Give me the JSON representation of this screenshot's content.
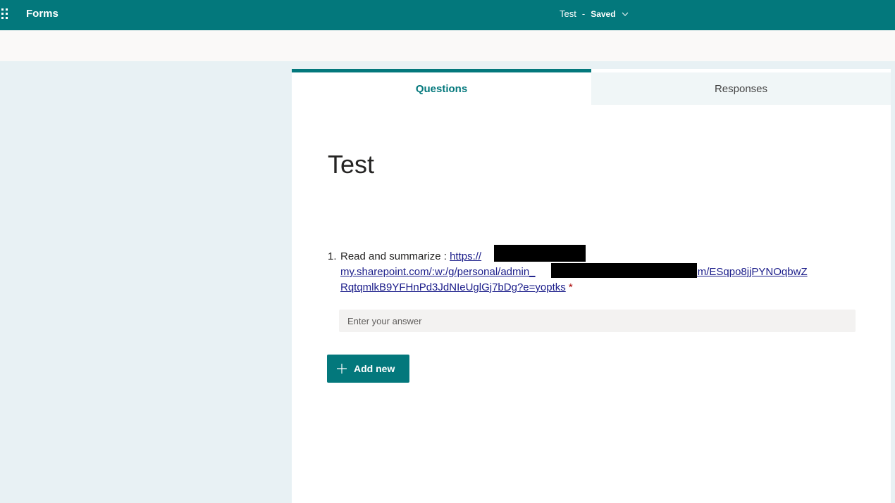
{
  "app": {
    "name": "Forms",
    "form_name": "Test",
    "separator": "-",
    "save_status": "Saved"
  },
  "tabs": [
    {
      "label": "Questions",
      "active": true
    },
    {
      "label": "Responses",
      "active": false
    }
  ],
  "form": {
    "title": "Test",
    "question": {
      "number": "1.",
      "prompt": "Read and summarize : ",
      "link_line1": "https://",
      "link_line2": "my.sharepoint.com/:w:/g/personal/admin_",
      "link_line2_end": "_com/ESqpo8jjPYNOqbwZ",
      "link_line3": "RqtqmlkB9YFHnPd3JdNIeUglGj7bDg?e=yoptks",
      "required_marker": "*"
    },
    "answer_placeholder": "Enter your answer",
    "add_new_label": "Add new"
  },
  "colors": {
    "brand": "#03787c",
    "link": "#1b1d8a",
    "required": "#a80000"
  },
  "icons": {
    "app_launcher": "waffle-icon",
    "dropdown": "chevron-down-icon",
    "add": "plus-icon"
  }
}
